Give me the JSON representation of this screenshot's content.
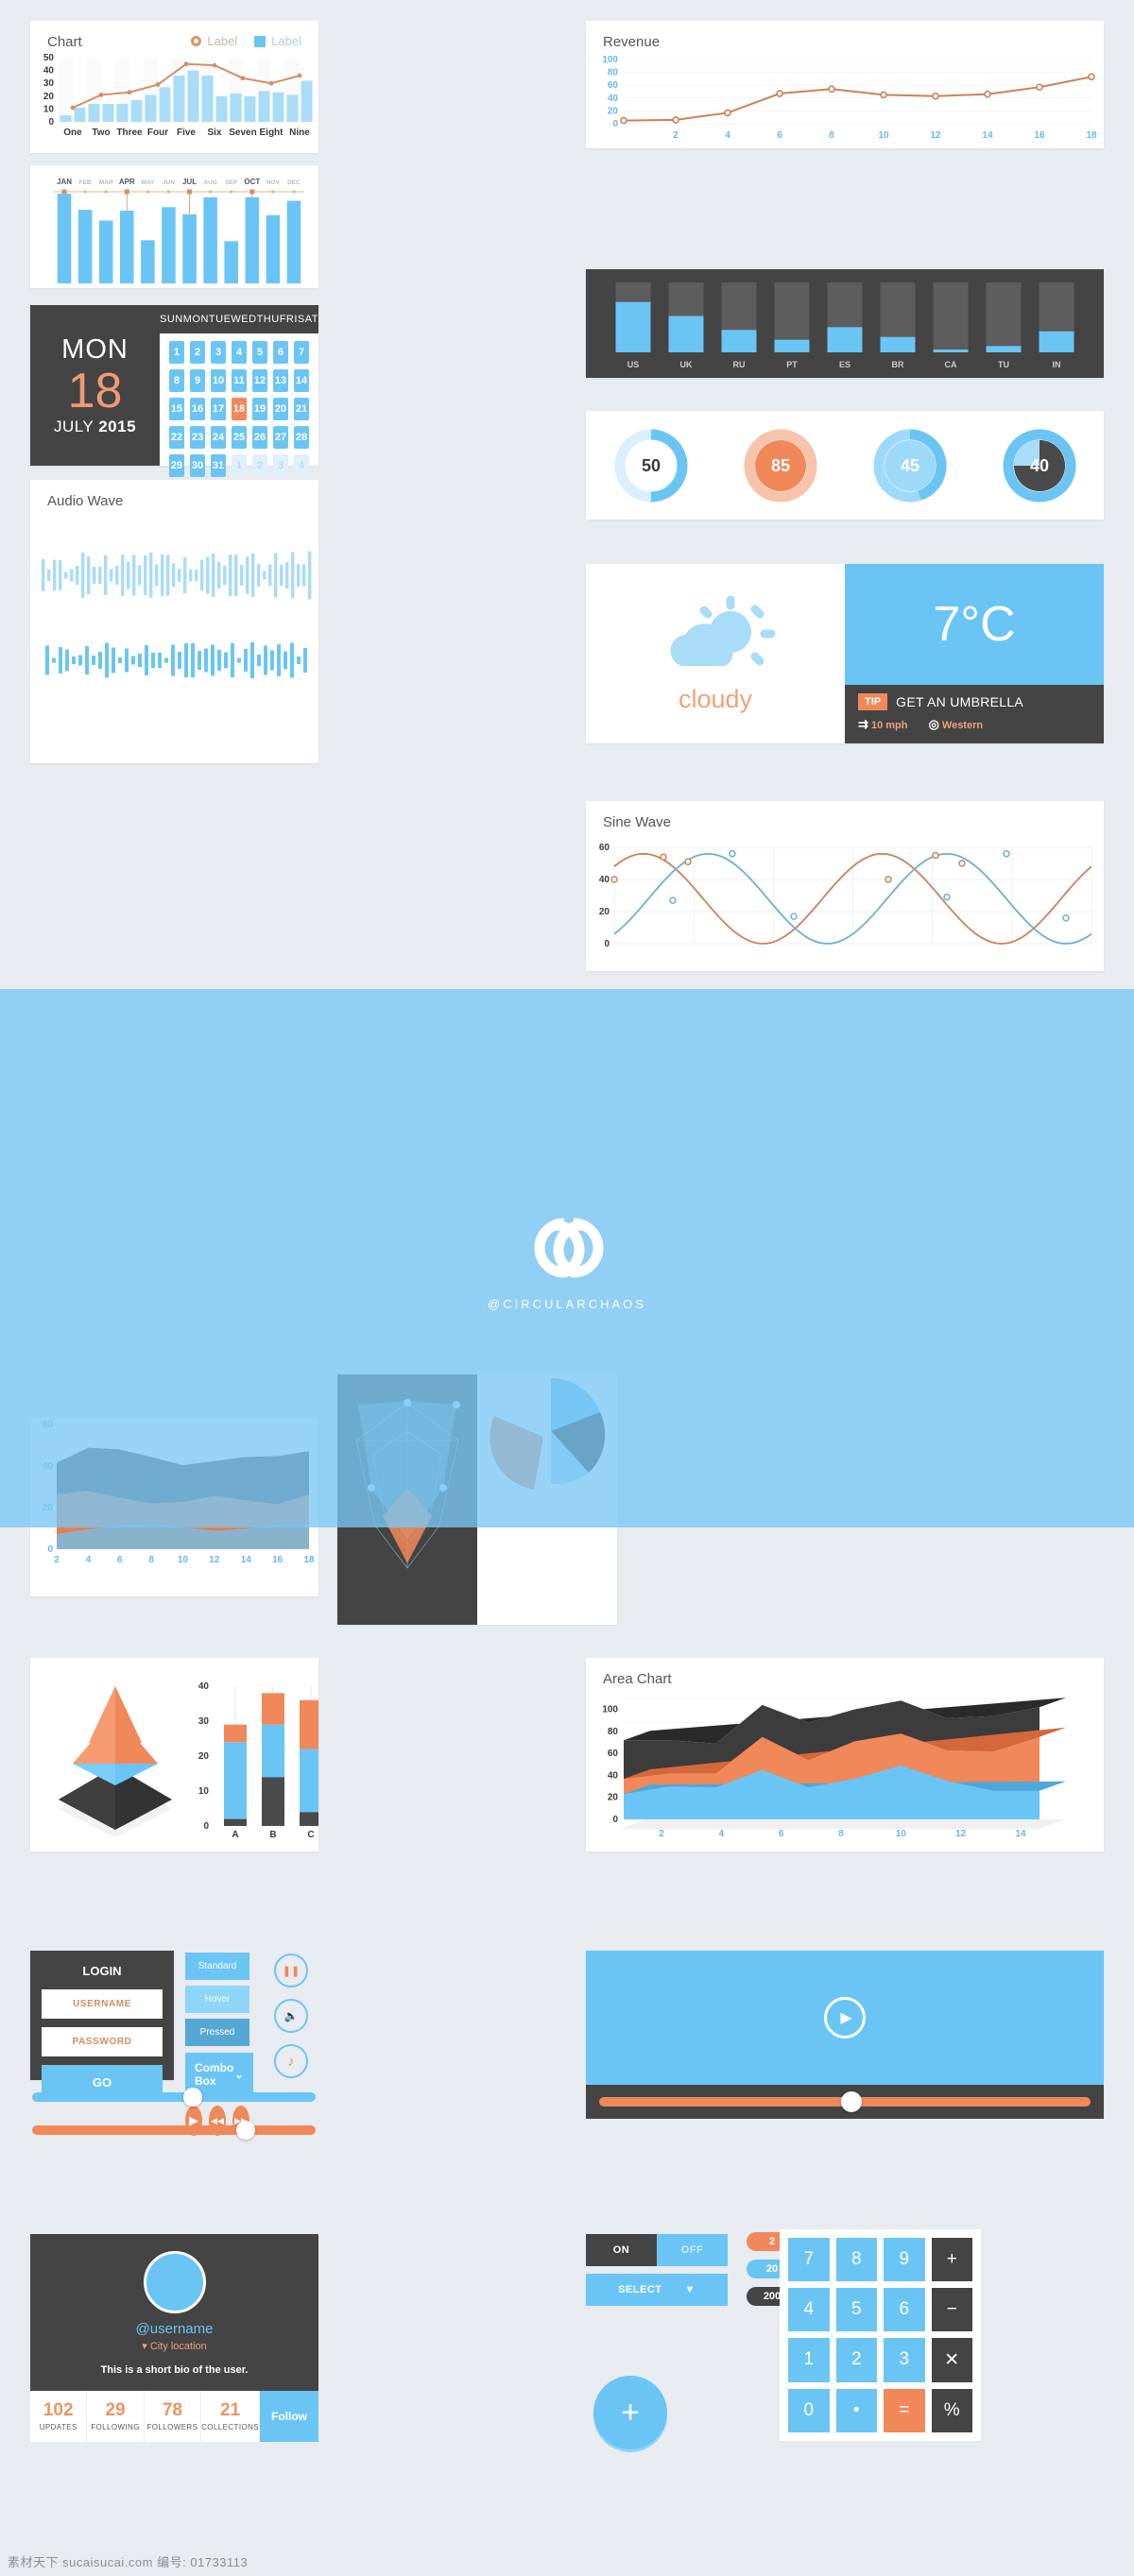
{
  "chart_card": {
    "title": "Chart",
    "legend": [
      {
        "label": "Label",
        "style": "circle",
        "color": "#e0916a"
      },
      {
        "label": "Label",
        "style": "square",
        "color": "#6ac5f5"
      }
    ]
  },
  "revenue_card": {
    "title": "Revenue"
  },
  "sine_card": {
    "title": "Sine Wave"
  },
  "audio_card": {
    "title": "Audio Wave"
  },
  "area_card": {
    "title": "Area Chart"
  },
  "calendar": {
    "weekday": "MON",
    "day": "18",
    "month": "JULY",
    "year": "2015",
    "headers": [
      "SUN",
      "MON",
      "TUE",
      "WED",
      "THU",
      "FRI",
      "SAT"
    ],
    "days": [
      {
        "n": "1"
      },
      {
        "n": "2"
      },
      {
        "n": "3"
      },
      {
        "n": "4"
      },
      {
        "n": "5"
      },
      {
        "n": "6"
      },
      {
        "n": "7"
      },
      {
        "n": "8"
      },
      {
        "n": "9"
      },
      {
        "n": "10"
      },
      {
        "n": "11"
      },
      {
        "n": "12"
      },
      {
        "n": "13"
      },
      {
        "n": "14"
      },
      {
        "n": "15"
      },
      {
        "n": "16"
      },
      {
        "n": "17"
      },
      {
        "n": "18"
      },
      {
        "n": "19"
      },
      {
        "n": "20"
      },
      {
        "n": "21"
      },
      {
        "n": "22"
      },
      {
        "n": "23"
      },
      {
        "n": "24"
      },
      {
        "n": "25"
      },
      {
        "n": "26"
      },
      {
        "n": "27"
      },
      {
        "n": "28"
      },
      {
        "n": "29"
      },
      {
        "n": "30"
      },
      {
        "n": "31"
      },
      {
        "n": "1"
      },
      {
        "n": "2"
      },
      {
        "n": "3"
      },
      {
        "n": "4"
      }
    ],
    "today_index": 17,
    "muted_from": 31
  },
  "weather": {
    "condition": "cloudy",
    "temperature": "7°C",
    "tip_badge": "TIP",
    "tip_text": "GET AN UMBRELLA",
    "wind": "10 mph",
    "direction": "Western"
  },
  "gauges": [
    {
      "value": "50",
      "percent": 50,
      "style": "light-ring",
      "track": "#d9effb",
      "fill": "#6ac5f5",
      "center": "#ffffff",
      "text": "#3a3a3a"
    },
    {
      "value": "85",
      "percent": 85,
      "style": "orange",
      "track": "#f7c4ab",
      "fill": "#f7c4ab",
      "center": "#f0885a",
      "text": "#ffffff"
    },
    {
      "value": "45",
      "percent": 45,
      "style": "blue",
      "track": "#9ddafa",
      "fill": "#6ac5f5",
      "center": "#9ddafa",
      "text": "#ffffff"
    },
    {
      "value": "40",
      "percent": 40,
      "style": "dark",
      "track": "#6ac5f5",
      "fill": "#6ac5f5",
      "center": "#4a4a4a",
      "text": "#ffffff"
    }
  ],
  "login": {
    "title": "LOGIN",
    "username_placeholder": "USERNAME",
    "password_placeholder": "PASSWORD",
    "submit": "GO"
  },
  "buttons": {
    "standard": "Standard",
    "hover": "Hover",
    "pressed": "Pressed",
    "combo": "Combo Box",
    "combo_caret": "⌄"
  },
  "media_icons": {
    "play": "▶",
    "rewind": "◀◀",
    "forward": "▶▶",
    "pause": "❚❚",
    "volume": "🔈",
    "music": "♪"
  },
  "video_player": {
    "play_icon": "▶"
  },
  "profile": {
    "username": "@username",
    "location": "City location",
    "location_pin": "▾",
    "bio": "This is a short bio of the user.",
    "stats": [
      {
        "value": "102",
        "label": "UPDATES"
      },
      {
        "value": "29",
        "label": "FOLLOWING"
      },
      {
        "value": "78",
        "label": "FOLLOWERS"
      },
      {
        "value": "21",
        "label": "COLLECTIONS"
      }
    ],
    "follow": "Follow"
  },
  "toggle": {
    "on": "ON",
    "off": "OFF",
    "select": "SELECT",
    "select_caret": "▼"
  },
  "pills": [
    {
      "value": "2",
      "color": "#f0885a"
    },
    {
      "value": "20",
      "color": "#6ac5f5"
    },
    {
      "value": "200",
      "color": "#444444"
    }
  ],
  "fab": {
    "icon": "+"
  },
  "calculator": {
    "keys": [
      {
        "label": "7",
        "type": "num"
      },
      {
        "label": "8",
        "type": "num"
      },
      {
        "label": "9",
        "type": "num"
      },
      {
        "label": "+",
        "type": "op"
      },
      {
        "label": "4",
        "type": "num"
      },
      {
        "label": "5",
        "type": "num"
      },
      {
        "label": "6",
        "type": "num"
      },
      {
        "label": "−",
        "type": "op"
      },
      {
        "label": "1",
        "type": "num"
      },
      {
        "label": "2",
        "type": "num"
      },
      {
        "label": "3",
        "type": "num"
      },
      {
        "label": "✕",
        "type": "op"
      },
      {
        "label": "0",
        "type": "num"
      },
      {
        "label": "•",
        "type": "num"
      },
      {
        "label": "=",
        "type": "eq"
      },
      {
        "label": "%",
        "type": "op"
      }
    ]
  },
  "footer": {
    "text": "素材天下 sucaisucai.com  编号: 01733113"
  },
  "watermark": {
    "handle": "@CIRCULARCHAOS"
  },
  "chart_data": [
    {
      "type": "bar",
      "id": "chart-combo",
      "title": "Chart",
      "categories": [
        "One",
        "Two",
        "Three",
        "Four",
        "Five",
        "Six",
        "Seven",
        "Eight",
        "Nine"
      ],
      "series": [
        {
          "name": "Label",
          "type": "bar",
          "color": "#a9dcf7",
          "values": [
            5,
            11,
            14,
            14,
            14,
            17,
            21,
            27,
            36,
            40,
            36,
            20,
            22,
            20,
            24,
            23,
            21,
            32
          ]
        },
        {
          "name": "Label",
          "type": "line",
          "color": "#d88d63",
          "values": [
            11,
            21,
            23,
            29,
            45,
            44,
            34,
            30,
            36
          ]
        }
      ],
      "ylabel": "",
      "xlabel": "",
      "ylim": [
        0,
        50
      ],
      "yticks": [
        0,
        10,
        20,
        30,
        40,
        50
      ],
      "grid": true
    },
    {
      "type": "line",
      "id": "revenue",
      "title": "Revenue",
      "x": [
        0,
        2,
        4,
        6,
        8,
        10,
        12,
        14,
        16,
        18
      ],
      "values": [
        5,
        6,
        17,
        47,
        54,
        45,
        43,
        46,
        57,
        73
      ],
      "color": "#cd8157",
      "ylim": [
        0,
        100
      ],
      "yticks": [
        0,
        20,
        40,
        60,
        80,
        100
      ],
      "xticks": [
        2,
        4,
        6,
        8,
        10,
        12,
        14,
        16,
        18
      ],
      "grid": true
    },
    {
      "type": "bar",
      "id": "country-bars",
      "categories": [
        "US",
        "UK",
        "RU",
        "PT",
        "ES",
        "BR",
        "CA",
        "TU",
        "IN"
      ],
      "values": [
        72,
        52,
        32,
        18,
        36,
        22,
        4,
        9,
        30
      ],
      "color": "#6ac5f5",
      "track": "#5d5d5d",
      "ylim": [
        0,
        100
      ],
      "background": "#444444"
    },
    {
      "type": "bar",
      "id": "months",
      "categories": [
        "JAN",
        "FEB",
        "MAR",
        "APR",
        "MAY",
        "JUN",
        "JUL",
        "AUG",
        "SEP",
        "OCT",
        "NOV",
        "DEC"
      ],
      "values": [
        100,
        82,
        70,
        81,
        48,
        85,
        77,
        96,
        47,
        96,
        76,
        92
      ],
      "highlighted": [
        "JAN",
        "APR",
        "JUL",
        "OCT"
      ],
      "color": "#6ac5f5",
      "marker_color": "#e08b5f"
    },
    {
      "type": "line",
      "id": "sine-wave",
      "title": "Sine Wave",
      "series": [
        {
          "name": "orange",
          "color": "#cd8157",
          "values": [
            40,
            54,
            51,
            26,
            1,
            9,
            40,
            55,
            50,
            27,
            1
          ]
        },
        {
          "name": "blue",
          "color": "#6ab0d8",
          "values": [
            0,
            27,
            56,
            47,
            17,
            0,
            1,
            29,
            56,
            53,
            16
          ]
        }
      ],
      "ylim": [
        0,
        60
      ],
      "yticks": [
        0,
        20,
        40,
        60
      ],
      "grid": true
    },
    {
      "type": "area",
      "id": "stacked-area-smooth",
      "x": [
        2,
        4,
        6,
        8,
        10,
        12,
        14,
        16,
        18
      ],
      "series": [
        {
          "name": "blue",
          "color": "#7fb9d9",
          "values": [
            18,
            24,
            29,
            31,
            27,
            22,
            25,
            30,
            32
          ]
        },
        {
          "name": "orange",
          "color": "#e07f52",
          "values": [
            48,
            46,
            33,
            24,
            30,
            42,
            34,
            24,
            34
          ]
        },
        {
          "name": "dark",
          "color": "#4a4a4a",
          "values": [
            38,
            52,
            58,
            56,
            44,
            42,
            52,
            58,
            52
          ]
        }
      ],
      "ylim": [
        0,
        60
      ],
      "yticks": [
        0,
        20,
        40,
        60
      ],
      "xticks": [
        2,
        4,
        6,
        8,
        10,
        12,
        14,
        16,
        18
      ]
    },
    {
      "type": "bar",
      "id": "stacked-bars-abc",
      "categories": [
        "A",
        "B",
        "C"
      ],
      "series": [
        {
          "name": "dark",
          "color": "#4a4a4a",
          "values": [
            2,
            14,
            4
          ]
        },
        {
          "name": "blue",
          "color": "#6ac5f5",
          "values": [
            22,
            15,
            18
          ]
        },
        {
          "name": "orange",
          "color": "#f0885a",
          "values": [
            5,
            9,
            14
          ]
        }
      ],
      "ylim": [
        0,
        40
      ],
      "yticks": [
        0,
        10,
        20,
        30,
        40
      ]
    },
    {
      "type": "pie",
      "id": "pyramid-3d",
      "slices": [
        {
          "name": "top",
          "color": "#f0885a"
        },
        {
          "name": "middle",
          "color": "#6ac5f5"
        },
        {
          "name": "base",
          "color": "#3c3c3c"
        }
      ]
    },
    {
      "type": "area",
      "id": "area-chart-3d",
      "title": "Area Chart",
      "x": [
        2,
        4,
        6,
        8,
        10,
        12,
        14
      ],
      "series": [
        {
          "name": "blue",
          "color": "#6ac5f5",
          "values": [
            23,
            30,
            29,
            45,
            29,
            37,
            49,
            35,
            26,
            26
          ]
        },
        {
          "name": "orange",
          "color": "#f0885a",
          "values": [
            14,
            12,
            13,
            30,
            25,
            34,
            29,
            28,
            36,
            49
          ]
        },
        {
          "name": "dark",
          "color": "#3c3c3c",
          "values": [
            35,
            30,
            27,
            29,
            34,
            29,
            30,
            29,
            32,
            27
          ]
        }
      ],
      "ylim": [
        0,
        100
      ],
      "yticks": [
        0,
        20,
        40,
        60,
        80,
        100
      ],
      "xticks": [
        2,
        4,
        6,
        8,
        10,
        12,
        14
      ]
    },
    {
      "type": "pie",
      "id": "exploded-pie",
      "slices": [
        {
          "name": "blue",
          "color": "#6ac5f5",
          "value": 45
        },
        {
          "name": "orange",
          "color": "#f0885a",
          "value": 35
        },
        {
          "name": "dark",
          "color": "#3c3c3c",
          "value": 20
        }
      ]
    }
  ]
}
